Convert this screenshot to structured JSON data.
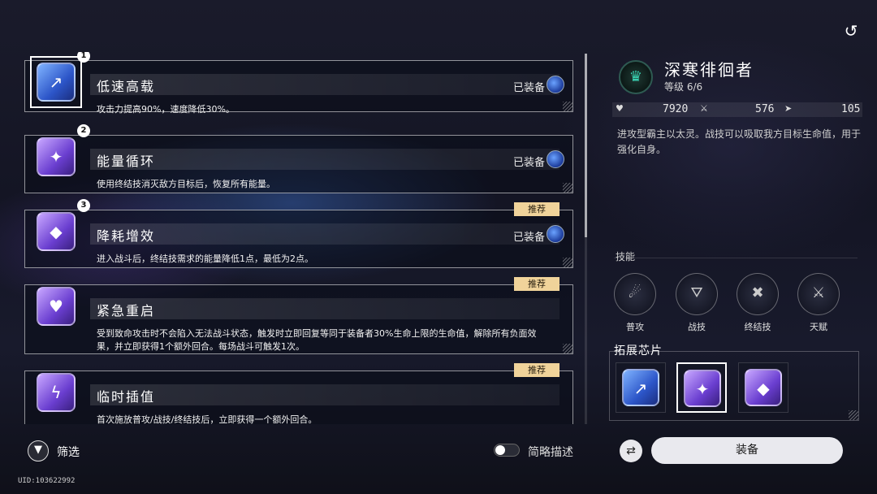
{
  "chips": [
    {
      "num": "1",
      "title": "低速高载",
      "status": "已装备",
      "recommend": "",
      "desc": "攻击力提高90%，速度降低30%。",
      "color": "blue",
      "glyph": "↗",
      "icon": "speed-chip-icon"
    },
    {
      "num": "2",
      "title": "能量循环",
      "status": "已装备",
      "recommend": "",
      "desc": "使用终结技消灭敌方目标后，恢复所有能量。",
      "color": "purple",
      "glyph": "✦",
      "icon": "energy-chip-icon"
    },
    {
      "num": "3",
      "title": "降耗增效",
      "status": "已装备",
      "recommend": "推荐",
      "desc": "进入战斗后，终结技需求的能量降低1点，最低为2点。",
      "color": "purple",
      "glyph": "◆",
      "icon": "efficiency-chip-icon"
    },
    {
      "num": "",
      "title": "紧急重启",
      "status": "",
      "recommend": "推荐",
      "desc": "受到致命攻击时不会陷入无法战斗状态，触发时立即回复等同于装备者30%生命上限的生命值，解除所有负面效果，并立即获得1个额外回合。每场战斗可触发1次。",
      "color": "purple",
      "glyph": "♥",
      "icon": "reboot-chip-icon"
    },
    {
      "num": "",
      "title": "临时插值",
      "status": "",
      "recommend": "推荐",
      "desc": "首次施放普攻/战技/终结技后，立即获得一个额外回合。",
      "color": "purple",
      "glyph": "ϟ",
      "icon": "interpolation-chip-icon"
    }
  ],
  "filter": {
    "label": "筛选",
    "icon": "filter-icon"
  },
  "toggle": {
    "label": "简略描述",
    "on": false
  },
  "uid": "UID:103622992",
  "character": {
    "name": "深寒徘徊者",
    "level": "等级 6/6",
    "hp": "7920",
    "atk": "576",
    "spd": "105",
    "desc": "进攻型霸主以太灵。战技可以吸取我方目标生命值，用于强化自身。"
  },
  "skills_label": "技能",
  "skills": [
    {
      "label": "普攻",
      "glyph": "☄",
      "icon": "basic-attack-icon"
    },
    {
      "label": "战技",
      "glyph": "⛛",
      "icon": "skill-icon"
    },
    {
      "label": "终结技",
      "glyph": "✖",
      "icon": "ultimate-icon"
    },
    {
      "label": "天赋",
      "glyph": "⚔",
      "icon": "talent-icon"
    }
  ],
  "extension_label": "拓展芯片",
  "equip_label": "装备",
  "colors": {
    "recommend": "#f0d39a",
    "accent_blue": "#2c55c8",
    "accent_purple": "#6a3ed0"
  }
}
